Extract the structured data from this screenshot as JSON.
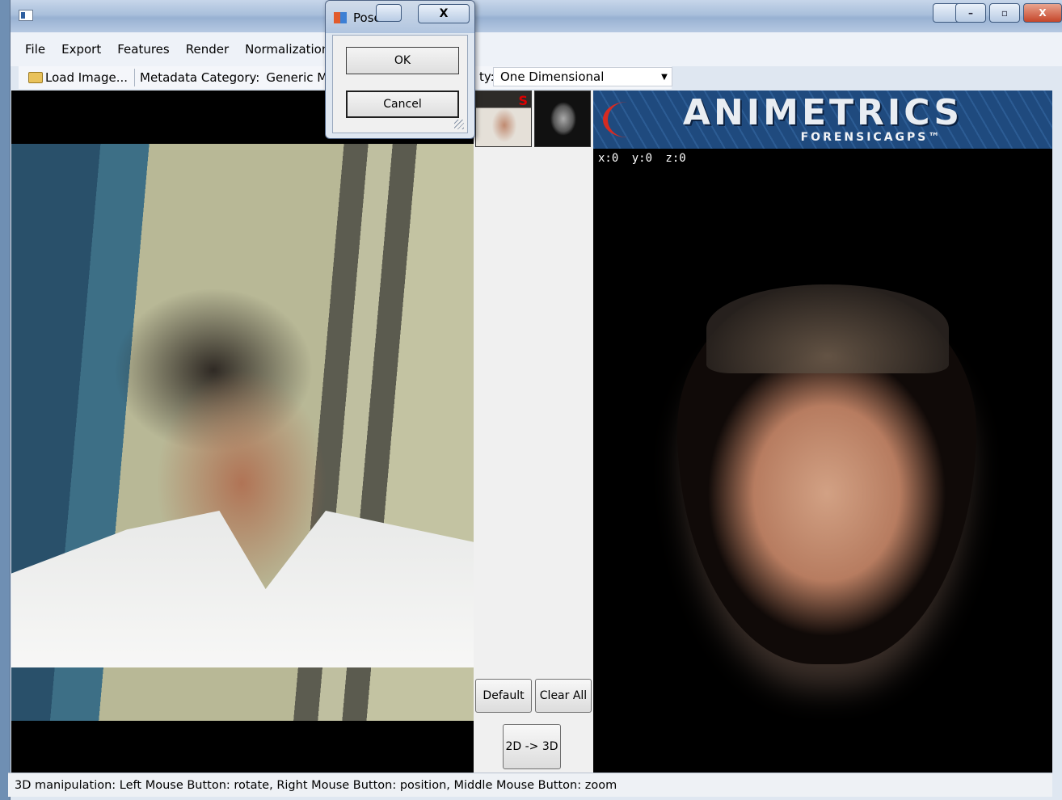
{
  "window": {
    "caption_close": "X"
  },
  "menu": {
    "items": [
      "File",
      "Export",
      "Features",
      "Render",
      "Normalization"
    ]
  },
  "toolbar": {
    "load_label": "Load Image...",
    "metadata_label": "Metadata Category:",
    "metadata_value": "Generic Male",
    "partial_label": "ty:",
    "combo_value": "One Dimensional"
  },
  "middle": {
    "thumb_mark": "S",
    "default_label": "Default",
    "clear_label": "Clear All",
    "convert_label": "2D -> 3D"
  },
  "banner": {
    "title": "ANIMETRICS",
    "subtitle": "FORENSICAGPS™"
  },
  "coords": {
    "text": "x:0  y:0  z:0"
  },
  "status": {
    "text": "3D manipulation:  Left Mouse Button: rotate,  Right Mouse Button: position,  Middle Mouse Button: zoom"
  },
  "dialog": {
    "title": "Pose",
    "close": "X",
    "ok": "OK",
    "cancel": "Cancel"
  }
}
